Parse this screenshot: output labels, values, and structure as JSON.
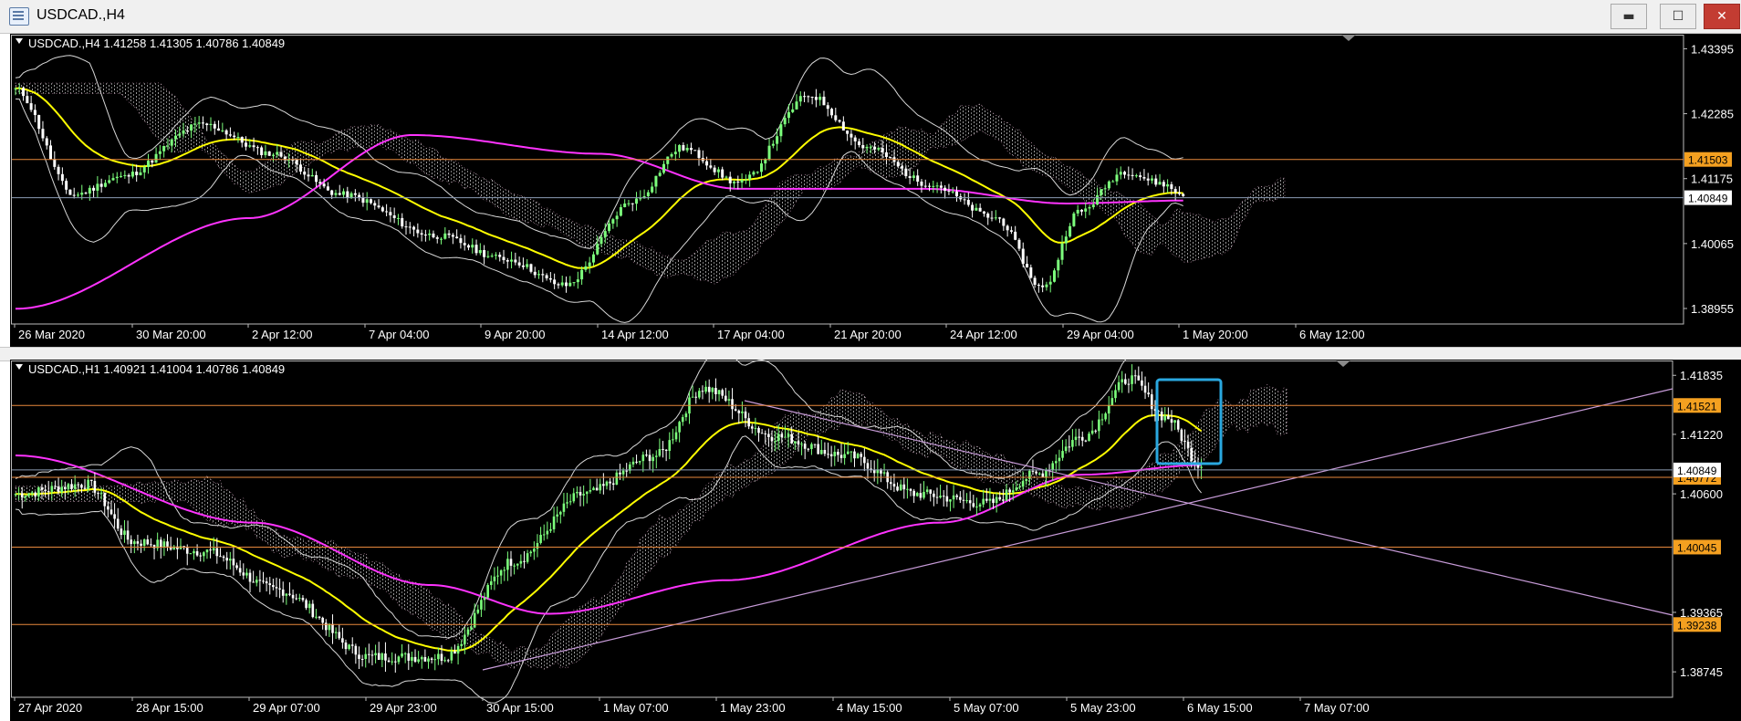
{
  "window": {
    "title": "USDCAD.,H4",
    "controls": {
      "minimize": "▬",
      "maximize": "☐",
      "close": "✕"
    }
  },
  "colors": {
    "background": "#000000",
    "bull_candle": "#7cff7c",
    "bear_candle": "#ffffff",
    "ma_fast": "#ffff00",
    "ma_slow": "#ff33ff",
    "bollinger": "#d8d8d8",
    "kumo": "#cccccc",
    "level_line": "#e8883c",
    "trendline": "#c79bd8",
    "highlight_box": "#2aa8e0",
    "price_label_bg": "#f4a020",
    "current_price_bg": "#ffffff"
  },
  "charts": [
    {
      "id": "h4",
      "header": "USDCAD.,H4  1.41258 1.41305 1.40786 1.40849",
      "y_axis": [
        "1.43395",
        "1.42285",
        "1.41175",
        "1.40065",
        "1.38955"
      ],
      "y_range": [
        1.3869,
        1.4362
      ],
      "x_axis": [
        "26 Mar 2020",
        "30 Mar 20:00",
        "2 Apr 12:00",
        "7 Apr 04:00",
        "9 Apr 20:00",
        "14 Apr 12:00",
        "17 Apr 04:00",
        "21 Apr 20:00",
        "24 Apr 12:00",
        "29 Apr 04:00",
        "1 May 20:00",
        "6 May 12:00"
      ],
      "levels": [
        "1.41503"
      ],
      "current_price": "1.40849"
    },
    {
      "id": "h1",
      "header": "USDCAD.,H1  1.40921 1.41004 1.40786 1.40849",
      "y_axis": [
        "1.41835",
        "1.41220",
        "1.40849",
        "1.40600",
        "1.39365",
        "1.38745"
      ],
      "y_range": [
        1.3848,
        1.4198
      ],
      "x_axis": [
        "27 Apr 2020",
        "28 Apr 15:00",
        "29 Apr 07:00",
        "29 Apr 23:00",
        "30 Apr 15:00",
        "1 May 07:00",
        "1 May 23:00",
        "4 May 15:00",
        "5 May 07:00",
        "5 May 23:00",
        "6 May 15:00",
        "7 May 07:00"
      ],
      "levels": [
        "1.41521",
        "1.40772",
        "1.40045",
        "1.39238"
      ],
      "current_price": "1.40849"
    }
  ]
}
